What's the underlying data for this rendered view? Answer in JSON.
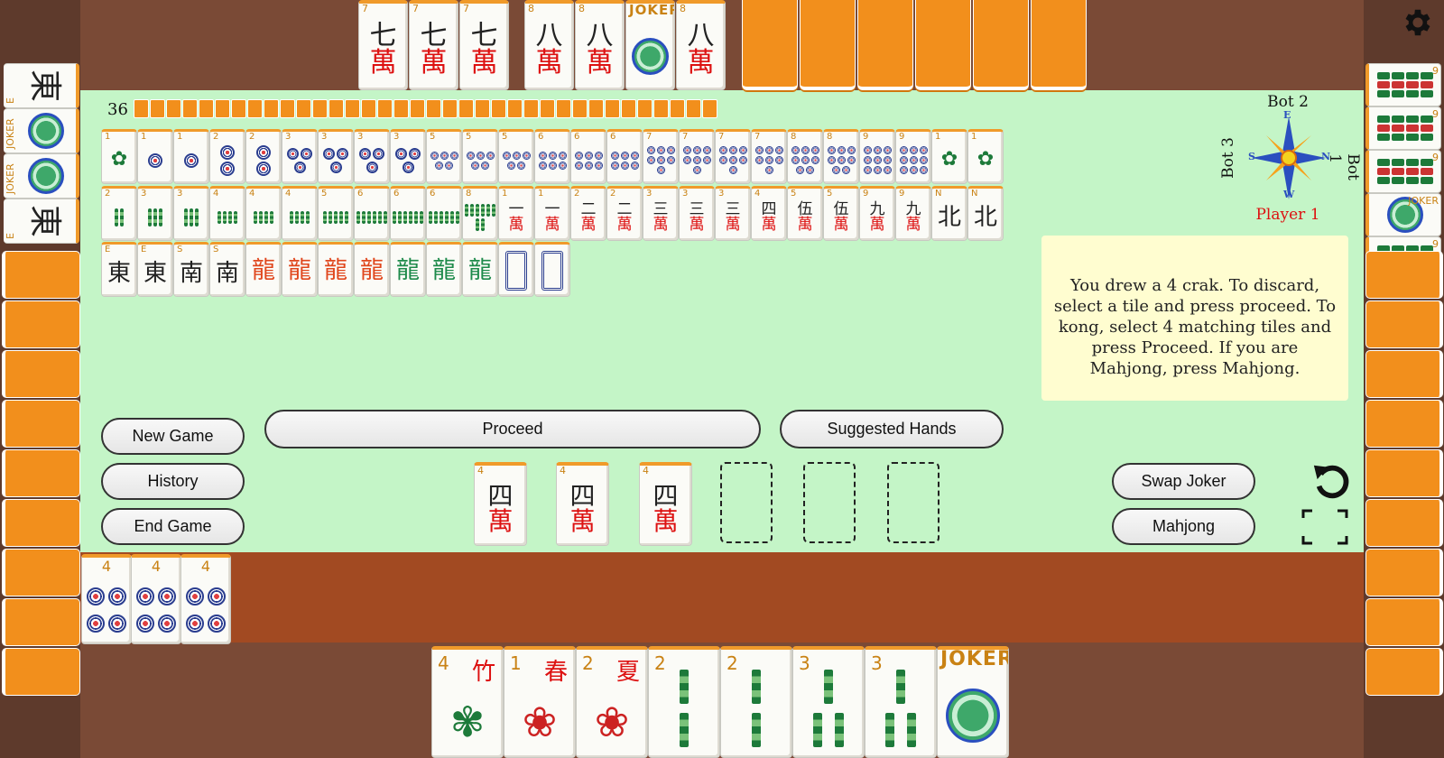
{
  "wall_count": "36",
  "compass": {
    "top": "Bot 2",
    "left": "Bot 3",
    "right": "Bot 1",
    "player": "Player 1",
    "E": "E",
    "S": "S",
    "N": "N",
    "W": "W"
  },
  "message": "You drew a 4 crak. To discard, select a tile and press proceed. To kong, select 4 matching tiles and press Proceed. If you are Mahjong, press Mahjong.",
  "buttons": {
    "new_game": "New Game",
    "history": "History",
    "end_game": "End Game",
    "proceed": "Proceed",
    "suggested": "Suggested Hands",
    "swap_joker": "Swap Joker",
    "mahjong": "Mahjong"
  },
  "colors": {
    "table": "#c4f5c7",
    "tile_back": "#f28f1c",
    "rail": "#a24a22",
    "message_bg": "#fffdd0",
    "crak": "#dd1111"
  },
  "bot2_exposed": [
    {
      "num": "7",
      "char": "七",
      "suit": "萬"
    },
    {
      "num": "7",
      "char": "七",
      "suit": "萬"
    },
    {
      "num": "7",
      "char": "七",
      "suit": "萬"
    },
    {
      "num": "8",
      "char": "八",
      "suit": "萬"
    },
    {
      "num": "8",
      "char": "八",
      "suit": "萬"
    },
    {
      "num": "JOKER",
      "char": "",
      "suit": ""
    },
    {
      "num": "8",
      "char": "八",
      "suit": "萬"
    }
  ],
  "discards_row1": [
    "1",
    "1",
    "1",
    "2",
    "2",
    "3",
    "3",
    "3",
    "3",
    "5",
    "5",
    "5",
    "6",
    "6",
    "6",
    "7",
    "7",
    "7",
    "7",
    "8",
    "8",
    "9",
    "9",
    "1",
    "1"
  ],
  "discards_row2": [
    "2",
    "3",
    "3",
    "4",
    "4",
    "4",
    "5",
    "6",
    "6",
    "6",
    "8",
    "1",
    "1",
    "2",
    "2",
    "3",
    "3",
    "3",
    "4",
    "5",
    "5",
    "9",
    "9",
    "N",
    "N"
  ],
  "discards_row2_chars": [
    "",
    "",
    "",
    "",
    "",
    "",
    "",
    "",
    "",
    "",
    "",
    "一",
    "一",
    "二",
    "二",
    "三",
    "三",
    "三",
    "四",
    "伍",
    "伍",
    "九",
    "九",
    "北",
    "北"
  ],
  "discards_row3": [
    "E",
    "E",
    "S",
    "S",
    "",
    "",
    "",
    "",
    "",
    "",
    "",
    "",
    ""
  ],
  "discards_row3_chars": [
    "東",
    "東",
    "南",
    "南",
    "",
    "",
    "",
    "",
    "",
    "",
    "",
    "",
    ""
  ],
  "drawn_tiles": [
    {
      "num": "4",
      "char": "四",
      "suit": "萬"
    },
    {
      "num": "4",
      "char": "四",
      "suit": "萬"
    },
    {
      "num": "4",
      "char": "四",
      "suit": "萬"
    }
  ],
  "left_exposed": [
    {
      "num": "4"
    },
    {
      "num": "4"
    },
    {
      "num": "4"
    }
  ],
  "player_hand": [
    {
      "num": "4",
      "char": "竹",
      "type": "flower"
    },
    {
      "num": "1",
      "char": "春",
      "type": "season"
    },
    {
      "num": "2",
      "char": "夏",
      "type": "season"
    },
    {
      "num": "2",
      "char": "",
      "type": "bam"
    },
    {
      "num": "2",
      "char": "",
      "type": "bam"
    },
    {
      "num": "3",
      "char": "",
      "type": "bam"
    },
    {
      "num": "3",
      "char": "",
      "type": "bam"
    },
    {
      "num": "JOKER",
      "char": "",
      "type": "joker"
    }
  ],
  "bot3_exposed": [
    {
      "num": "E",
      "char": "東"
    },
    {
      "num": "JOKER",
      "char": ""
    },
    {
      "num": "JOKER",
      "char": ""
    },
    {
      "num": "E",
      "char": "東"
    }
  ],
  "bot1_exposed": [
    {
      "num": "9"
    },
    {
      "num": "9"
    },
    {
      "num": "9"
    },
    {
      "num": "JOKER"
    },
    {
      "num": "9"
    }
  ]
}
